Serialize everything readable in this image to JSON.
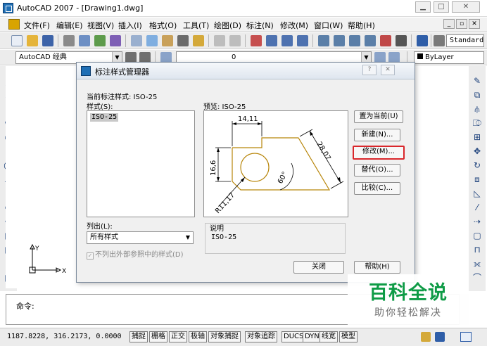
{
  "window": {
    "title": "AutoCAD 2007 - [Drawing1.dwg]"
  },
  "menu": {
    "items": [
      "文件(F)",
      "编辑(E)",
      "视图(V)",
      "插入(I)",
      "格式(O)",
      "工具(T)",
      "绘图(D)",
      "标注(N)",
      "修改(M)",
      "窗口(W)",
      "帮助(H)"
    ]
  },
  "toolbar": {
    "workspace": "AutoCAD 经典",
    "text_style": "Standard",
    "layer": "0",
    "linetype": "ByLayer"
  },
  "dialog": {
    "title": "标注样式管理器",
    "current_style_label": "当前标注样式: ISO-25",
    "styles_label": "样式(S):",
    "styles": [
      "ISO-25"
    ],
    "preview_label": "预览: ISO-25",
    "list_label": "列出(L):",
    "list_value": "所有样式",
    "xref_checkbox_label": "不列出外部参照中的样式(D)",
    "description_label": "说明",
    "description_value": "ISO-25",
    "buttons": {
      "set_current": "置为当前(U)",
      "new": "新建(N)...",
      "modify": "修改(M)...",
      "override": "替代(O)...",
      "compare": "比较(C)...",
      "close": "关闭",
      "help": "帮助(H)"
    },
    "preview_dims": {
      "top": "14,11",
      "left": "16,6",
      "right": "28,07",
      "angle": "60°",
      "radius": "R11,17"
    }
  },
  "command": {
    "prompt": "命令:"
  },
  "status": {
    "coords": "1187.8228, 316.2173, 0.0000",
    "buttons": [
      "捕捉",
      "栅格",
      "正交",
      "极轴",
      "对象捕捉",
      "对象追踪",
      "DUCS",
      "DYN",
      "线宽",
      "模型"
    ]
  },
  "ucs": {
    "y": "Y",
    "x": "X"
  },
  "watermark": {
    "title": "百科全说",
    "subtitle": "助你轻松解决"
  },
  "colors": {
    "accent_red": "#d9262b",
    "watermark_green": "#0e9b46",
    "preview_line": "#b8860b",
    "dimension_line": "#000000"
  }
}
